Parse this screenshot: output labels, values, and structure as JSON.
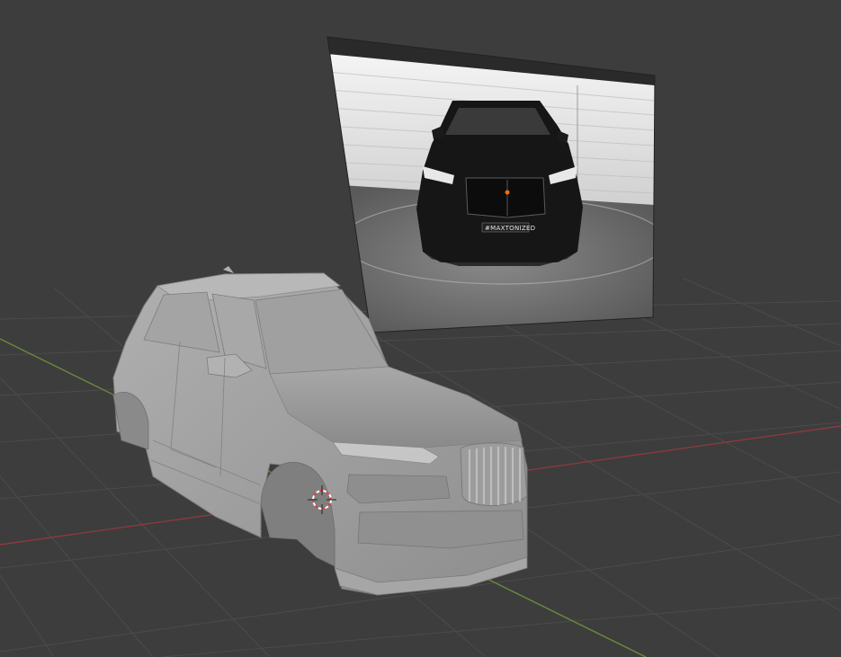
{
  "viewport": {
    "background": "#3d3d3d",
    "grid_color": "#4a4a4a",
    "x_axis_color": "#8a3a40",
    "y_axis_color": "#6a8a3a"
  },
  "reference_image": {
    "plate_text": "#MAXTONIZED",
    "indicator_color": "#ff6a00"
  },
  "model": {
    "clay_color": "#9a9a9a"
  },
  "cursor": {
    "colors": [
      "#e04040",
      "#ffffff"
    ]
  }
}
